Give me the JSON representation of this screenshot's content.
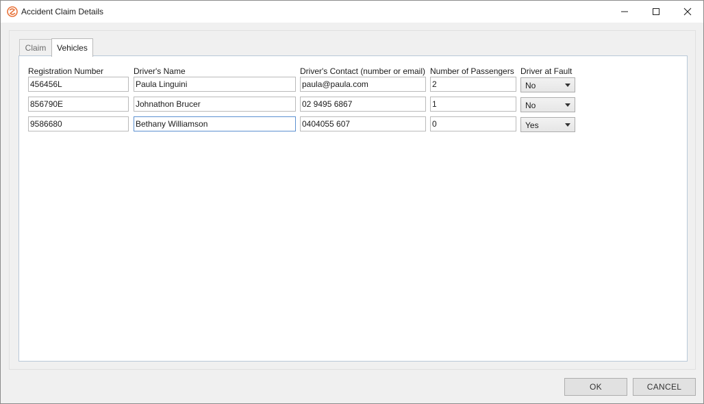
{
  "window": {
    "title": "Accident Claim Details",
    "controls": {
      "minimize": "minimize-icon",
      "maximize": "maximize-icon",
      "close": "close-icon"
    }
  },
  "tabs": [
    {
      "label": "Claim",
      "selected": false
    },
    {
      "label": "Vehicles",
      "selected": true
    }
  ],
  "vehicles": {
    "columns": [
      "Registration Number",
      "Driver's Name",
      "Driver's Contact (number or email)",
      "Number of Passengers",
      "Driver at Fault"
    ],
    "rows": [
      {
        "registration": "456456L",
        "driver_name": "Paula Linguini",
        "contact": "paula@paula.com",
        "passengers": "2",
        "at_fault": "No"
      },
      {
        "registration": "856790E",
        "driver_name": "Johnathon Brucer",
        "contact": "02 9495 6867",
        "passengers": "1",
        "at_fault": "No"
      },
      {
        "registration": "9586680",
        "driver_name": "Bethany Williamson",
        "contact": "0404055 607",
        "passengers": "0",
        "at_fault": "Yes"
      }
    ]
  },
  "buttons": {
    "ok": "OK",
    "cancel": "CANCEL"
  },
  "colors": {
    "accent_orange": "#e8733a",
    "focus_border": "#5a8fd0"
  }
}
